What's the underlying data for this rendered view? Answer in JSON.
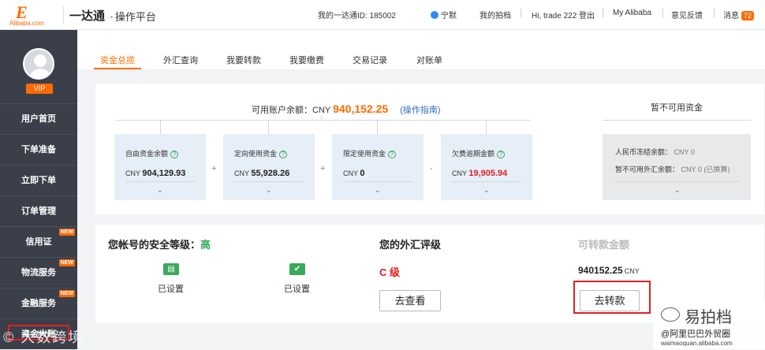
{
  "header": {
    "logo_mark": "E",
    "logo_text": "Alibaba.com",
    "brand": "一达通",
    "subtitle": "操作平台",
    "account_id_label": "我的一达通ID: 185002",
    "qq_label": "宁默",
    "nav": [
      "我的拍档",
      "Hi, trade 222 登出",
      "My Alibaba",
      "意见反馈"
    ],
    "messages_label": "消息",
    "messages_count": "72"
  },
  "sidebar": {
    "vip": "VIP",
    "items": [
      {
        "label": "用户首页",
        "new": ""
      },
      {
        "label": "下单准备",
        "new": ""
      },
      {
        "label": "立即下单",
        "new": ""
      },
      {
        "label": "订单管理",
        "new": ""
      },
      {
        "label": "信用证",
        "new": "NEW"
      },
      {
        "label": "物流服务",
        "new": "NEW"
      },
      {
        "label": "金融服务",
        "new": "NEW"
      },
      {
        "label": "资金大账",
        "new": ""
      }
    ]
  },
  "tabs": [
    "资金总揽",
    "外汇查询",
    "我要转款",
    "我要缴费",
    "交易记录",
    "对账单"
  ],
  "active_tab": 0,
  "balance": {
    "label": "可用账户余额：",
    "currency": "CNY",
    "amount": "940,152.25",
    "guide_link": "(操作指南)",
    "items": [
      {
        "label": "自由资金余额",
        "currency": "CNY",
        "value": "904,129.93",
        "red": false
      },
      {
        "label": "定向使用资金",
        "currency": "CNY",
        "value": "55,928.26",
        "red": false
      },
      {
        "label": "限定使用资金",
        "currency": "CNY",
        "value": "0",
        "red": false
      },
      {
        "label": "欠费逾期金额",
        "currency": "CNY",
        "value": "19,905.94",
        "red": true
      }
    ],
    "operators": [
      "+",
      "+",
      "-"
    ]
  },
  "frozen": {
    "title": "暂不可用资金",
    "rmb_label": "人民币冻结余额：",
    "rmb_value": "CNY 0",
    "fx_label": "暂不可用外汇余额：",
    "fx_value": "CNY 0",
    "fx_note": "(已换算)"
  },
  "security": {
    "title": "您帐号的安全等级：",
    "level": "高",
    "items": [
      {
        "status": "已设置"
      },
      {
        "status": "已设置"
      }
    ]
  },
  "fx_rating": {
    "title": "您的外汇评级",
    "level": "C 级",
    "button": "去查看"
  },
  "transfer": {
    "title": "可转款金额",
    "amount": "940152.25",
    "currency": "CNY",
    "button": "去转款"
  },
  "watermarks": {
    "left": "© 大数跨境",
    "right_name": "易拍档",
    "right_sub": "@阿里巴巴外贸圈",
    "right_url": "waimaoquan.alibaba.com"
  },
  "colors": {
    "accent": "#ff6a00",
    "sidebar": "#3a3f4a",
    "success": "#3aa95a",
    "danger": "#e02020",
    "link": "#2d6cc0"
  }
}
